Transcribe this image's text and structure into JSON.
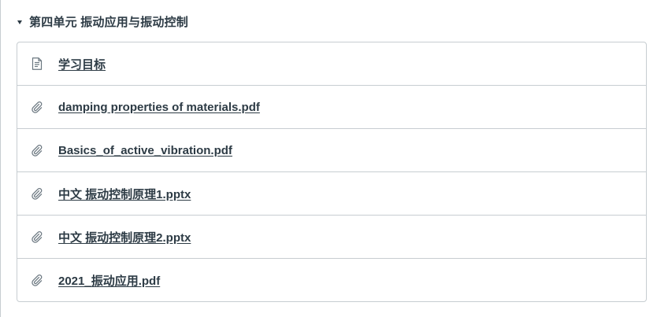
{
  "module": {
    "title": "第四单元 振动应用与振动控制",
    "items": [
      {
        "icon": "page-icon",
        "label": "学习目标"
      },
      {
        "icon": "paperclip-icon",
        "label": "damping properties of materials.pdf"
      },
      {
        "icon": "paperclip-icon",
        "label": "Basics_of_active_vibration.pdf"
      },
      {
        "icon": "paperclip-icon",
        "label": "中文 振动控制原理1.pptx"
      },
      {
        "icon": "paperclip-icon",
        "label": "中文 振动控制原理2.pptx"
      },
      {
        "icon": "paperclip-icon",
        "label": "2021_振动应用.pdf"
      }
    ]
  },
  "colors": {
    "text": "#2d3b45",
    "border": "#c7cdd1",
    "icon": "#6b7780"
  }
}
